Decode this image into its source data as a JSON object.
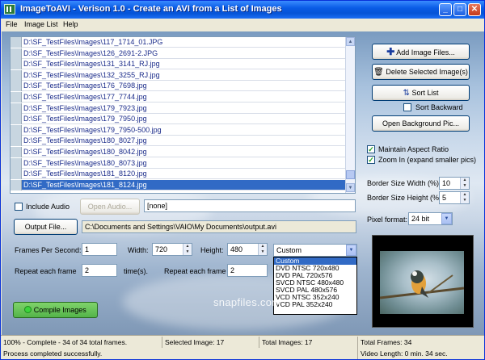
{
  "window": {
    "title": "ImageToAVI - Verison 1.0 - Create an AVI from a List of Images",
    "minimize": "_",
    "maximize": "□",
    "close": "✕"
  },
  "menu": [
    "File",
    "Image List",
    "Help"
  ],
  "image_list": [
    "D:\\SF_TestFiles\\Images\\117_1714_01.JPG",
    "D:\\SF_TestFiles\\Images\\126_2691-2.JPG",
    "D:\\SF_TestFiles\\Images\\131_3141_RJ.jpg",
    "D:\\SF_TestFiles\\Images\\132_3255_RJ.jpg",
    "D:\\SF_TestFiles\\Images\\176_7698.jpg",
    "D:\\SF_TestFiles\\Images\\177_7744.jpg",
    "D:\\SF_TestFiles\\Images\\179_7923.jpg",
    "D:\\SF_TestFiles\\Images\\179_7950.jpg",
    "D:\\SF_TestFiles\\Images\\179_7950-500.jpg",
    "D:\\SF_TestFiles\\Images\\180_8027.jpg",
    "D:\\SF_TestFiles\\Images\\180_8042.jpg",
    "D:\\SF_TestFiles\\Images\\180_8073.jpg",
    "D:\\SF_TestFiles\\Images\\181_8120.jpg",
    "D:\\SF_TestFiles\\Images\\181_8124.jpg"
  ],
  "selected_index": 13,
  "buttons": {
    "add_images": "Add Image Files...",
    "delete_selected": "Delete Selected Image(s)",
    "sort_list": "Sort List",
    "open_background": "Open Background Pic...",
    "open_audio": "Open Audio...",
    "output_file": "Output File...",
    "compile": "Compile Images"
  },
  "options": {
    "sort_backward": "Sort Backward",
    "maintain_aspect": "Maintain Aspect Ratio",
    "zoom_in": "Zoom In (expand smaller pics)",
    "include_audio": "Include Audio",
    "maintain_aspect_checked": true,
    "zoom_in_checked": true,
    "sort_backward_checked": false,
    "include_audio_checked": false
  },
  "audio_path": "[none]",
  "output_path": "C:\\Documents and Settings\\VAIO\\My Documents\\output.avi",
  "border": {
    "width_label": "Border Size Width (%):",
    "width_value": "10",
    "height_label": "Border Size Height (%):",
    "height_value": "5"
  },
  "pixel_format": {
    "label": "Pixel format:",
    "value": "24 bit"
  },
  "video": {
    "fps_label": "Frames Per Second:",
    "fps_value": "1",
    "width_label": "Width:",
    "width_value": "720",
    "height_label": "Height:",
    "height_value": "480",
    "repeat_label": "Repeat each frame",
    "repeat_value": "2",
    "repeat_unit": "time(s).",
    "repeat2_label": "Repeat each frame",
    "repeat2_value": "2"
  },
  "preset": {
    "selected": "Custom",
    "options": [
      "Custom",
      "DVD NTSC 720x480",
      "DVD PAL 720x576",
      "SVCD NTSC 480x480",
      "SVCD PAL 480x576",
      "VCD NTSC 352x240",
      "VCD PAL 352x240"
    ]
  },
  "watermark": "snapfiles.com",
  "status": {
    "progress": "100% - Complete - 34 of 34 total frames.",
    "selected_image": "Selected Image: 17",
    "total_images": "Total Images: 17",
    "total_frames": "Total Frames: 34",
    "message": "Process completed successfully.",
    "video_length": "Video Length: 0 min. 34 sec."
  },
  "colors": {
    "accent": "#316ac5",
    "list_text": "#1a2b8a",
    "compile_green": "#7fd36a"
  },
  "icons": {
    "add": "plus-icon",
    "delete": "trash-icon",
    "sort": "sort-arrows-icon",
    "compile": "green-dot-icon"
  }
}
